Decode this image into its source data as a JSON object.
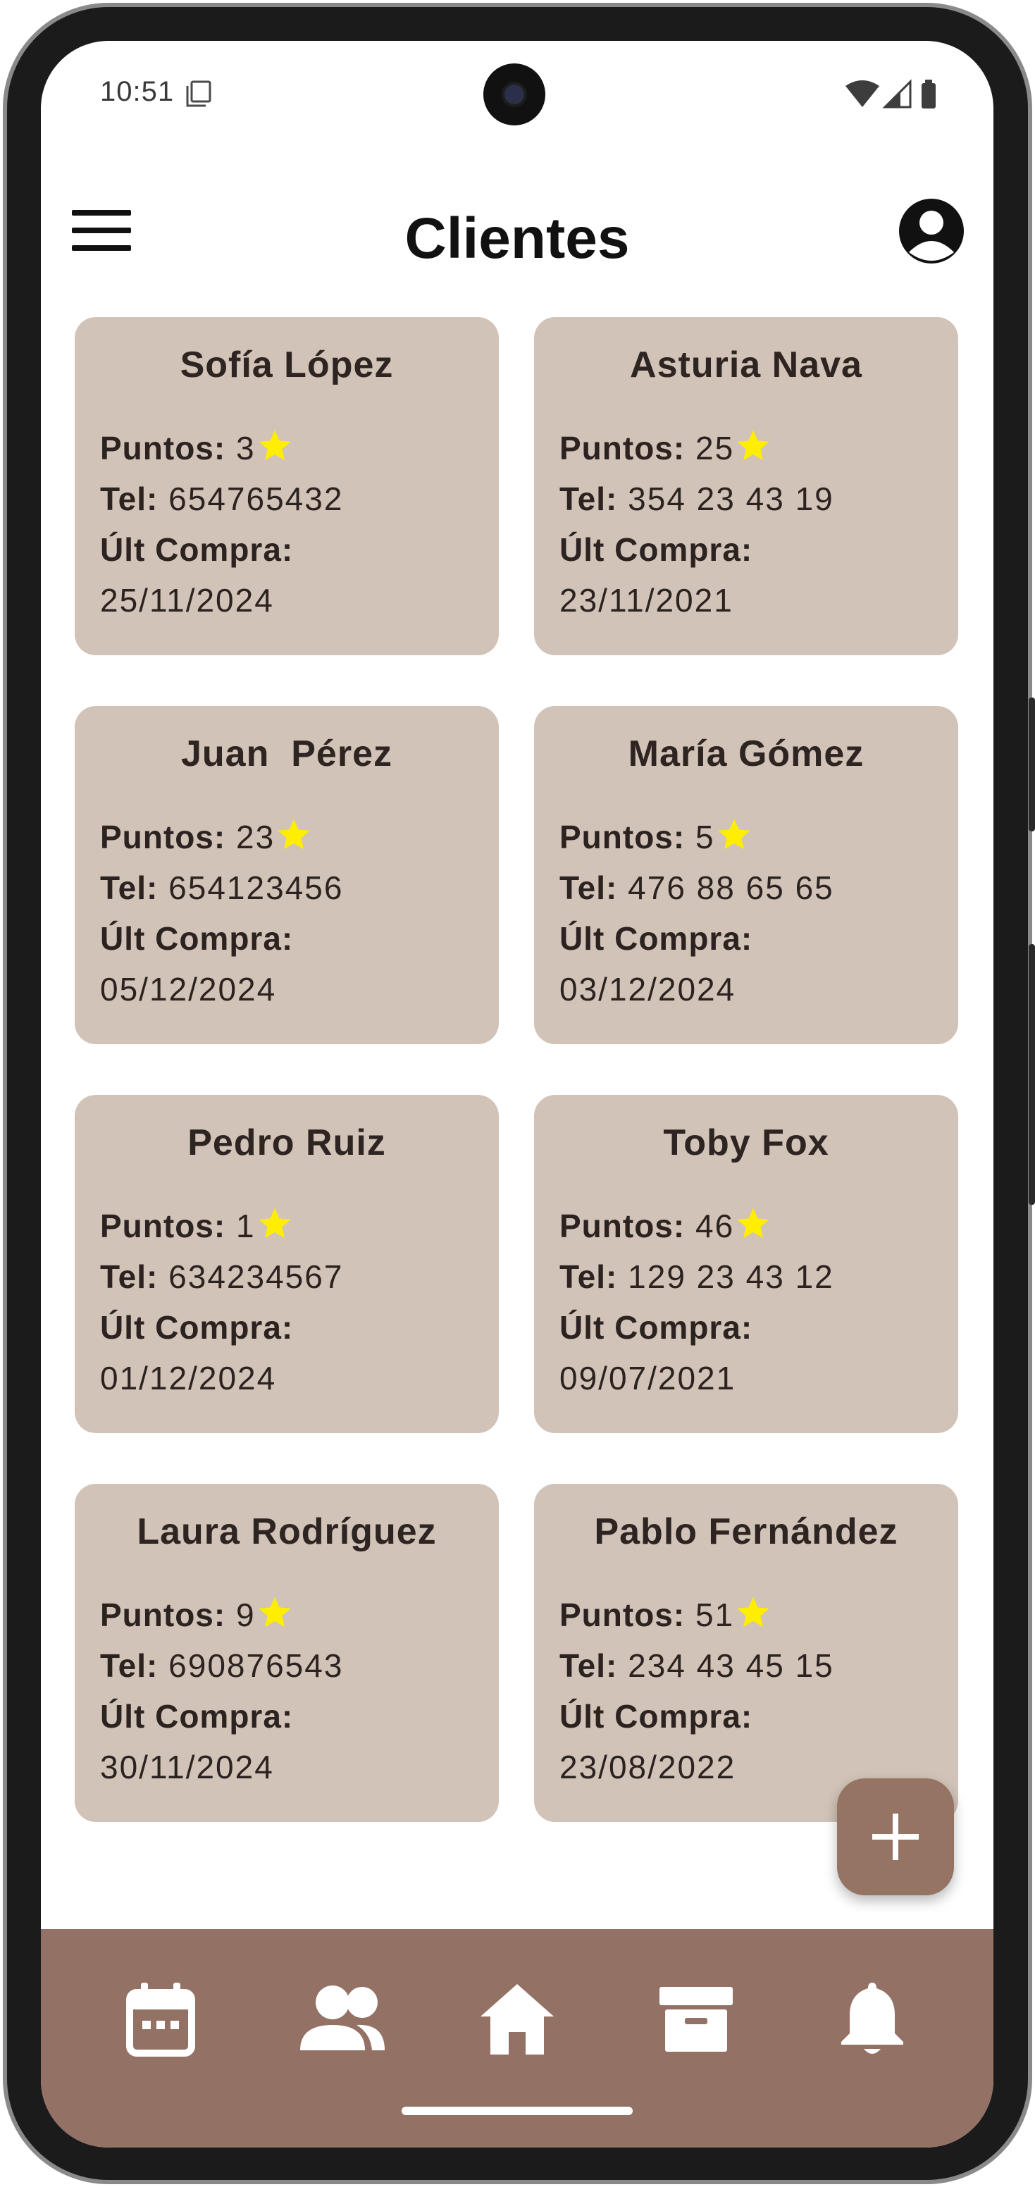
{
  "status_bar": {
    "time": "10:51"
  },
  "header": {
    "title": "Clientes",
    "menu_icon": "menu-icon",
    "profile_icon": "account-circle-icon"
  },
  "labels": {
    "points": "Puntos:",
    "phone": "Tel:",
    "last_purchase": "Últ Compra:"
  },
  "clients": [
    {
      "name": "Sofía López",
      "points": "3",
      "phone": "654765432",
      "last_purchase": "25/11/2024"
    },
    {
      "name": "Asturia Nava",
      "points": "25",
      "phone": "354 23 43 19",
      "last_purchase": "23/11/2021"
    },
    {
      "name": "Juan  Pérez",
      "points": "23",
      "phone": "654123456",
      "last_purchase": "05/12/2024"
    },
    {
      "name": "María Gómez",
      "points": "5",
      "phone": "476 88 65 65",
      "last_purchase": "03/12/2024"
    },
    {
      "name": "Pedro Ruiz",
      "points": "1",
      "phone": "634234567",
      "last_purchase": "01/12/2024"
    },
    {
      "name": "Toby Fox",
      "points": "46",
      "phone": "129 23 43 12",
      "last_purchase": "09/07/2021"
    },
    {
      "name": "Laura Rodríguez",
      "points": "9",
      "phone": "690876543",
      "last_purchase": "30/11/2024"
    },
    {
      "name": "Pablo Fernández",
      "points": "51",
      "phone": "234 43 45 15",
      "last_purchase": "23/08/2022"
    }
  ],
  "fab": {
    "icon": "plus-icon"
  },
  "bottom_nav": {
    "items": [
      {
        "icon": "calendar-icon"
      },
      {
        "icon": "people-icon"
      },
      {
        "icon": "home-icon"
      },
      {
        "icon": "archive-box-icon"
      },
      {
        "icon": "bell-icon"
      }
    ]
  },
  "colors": {
    "card_bg": "#d1c3b7",
    "nav_bg": "#937265",
    "fab_bg": "#967464",
    "star": "#ffee00",
    "text_dark": "#2c2321"
  }
}
